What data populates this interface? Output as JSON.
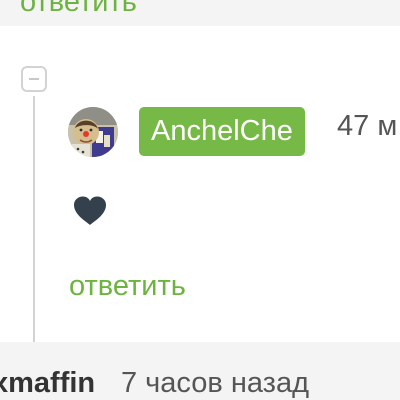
{
  "top_reply": {
    "label": "ответить"
  },
  "reply": {
    "author": "AnchelChe",
    "time": "47 м",
    "heart_icon": "heart-icon",
    "action_label": "ответить"
  },
  "next_comment": {
    "author": "xmaffin",
    "time": "7 часов назад"
  },
  "colors": {
    "accent_green": "#6db33f",
    "badge_green": "#76b947",
    "heart": "#34404c"
  }
}
